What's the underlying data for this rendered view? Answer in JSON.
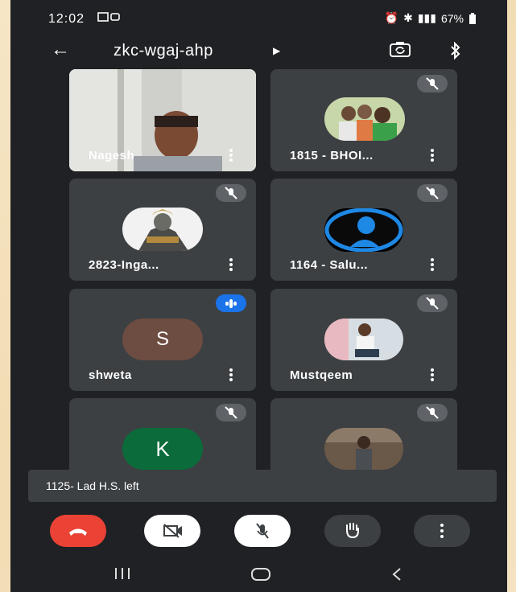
{
  "status_bar": {
    "time": "12:02",
    "battery": "67%"
  },
  "meeting": {
    "code": "zkc-wgaj-ahp"
  },
  "participants": [
    {
      "name": "Nagesh",
      "muted": false,
      "kind": "video"
    },
    {
      "name": "1815 - BHOI...",
      "muted": true,
      "kind": "photo"
    },
    {
      "name": "2823-Inga...",
      "muted": true,
      "kind": "photo"
    },
    {
      "name": "1164 - Salu...",
      "muted": true,
      "kind": "default-avatar"
    },
    {
      "name": "shweta",
      "muted": false,
      "kind": "initial",
      "initial": "S",
      "color": "#6d4c41"
    },
    {
      "name": "Mustqeem",
      "muted": true,
      "kind": "photo"
    },
    {
      "name": "",
      "muted": true,
      "kind": "initial",
      "initial": "K",
      "color": "#0b6b3a"
    },
    {
      "name": "",
      "muted": true,
      "kind": "photo"
    }
  ],
  "toast": {
    "text": "1125- Lad H.S. left"
  },
  "controls": [
    {
      "icon": "end-call-icon",
      "color": "#ea4335"
    },
    {
      "icon": "camera-off-icon",
      "color": "#ffffff"
    },
    {
      "icon": "mic-off-icon",
      "color": "#ffffff"
    },
    {
      "icon": "raise-hand-icon",
      "color": "#3c4043"
    },
    {
      "icon": "more-options-icon",
      "color": "#3c4043"
    }
  ]
}
